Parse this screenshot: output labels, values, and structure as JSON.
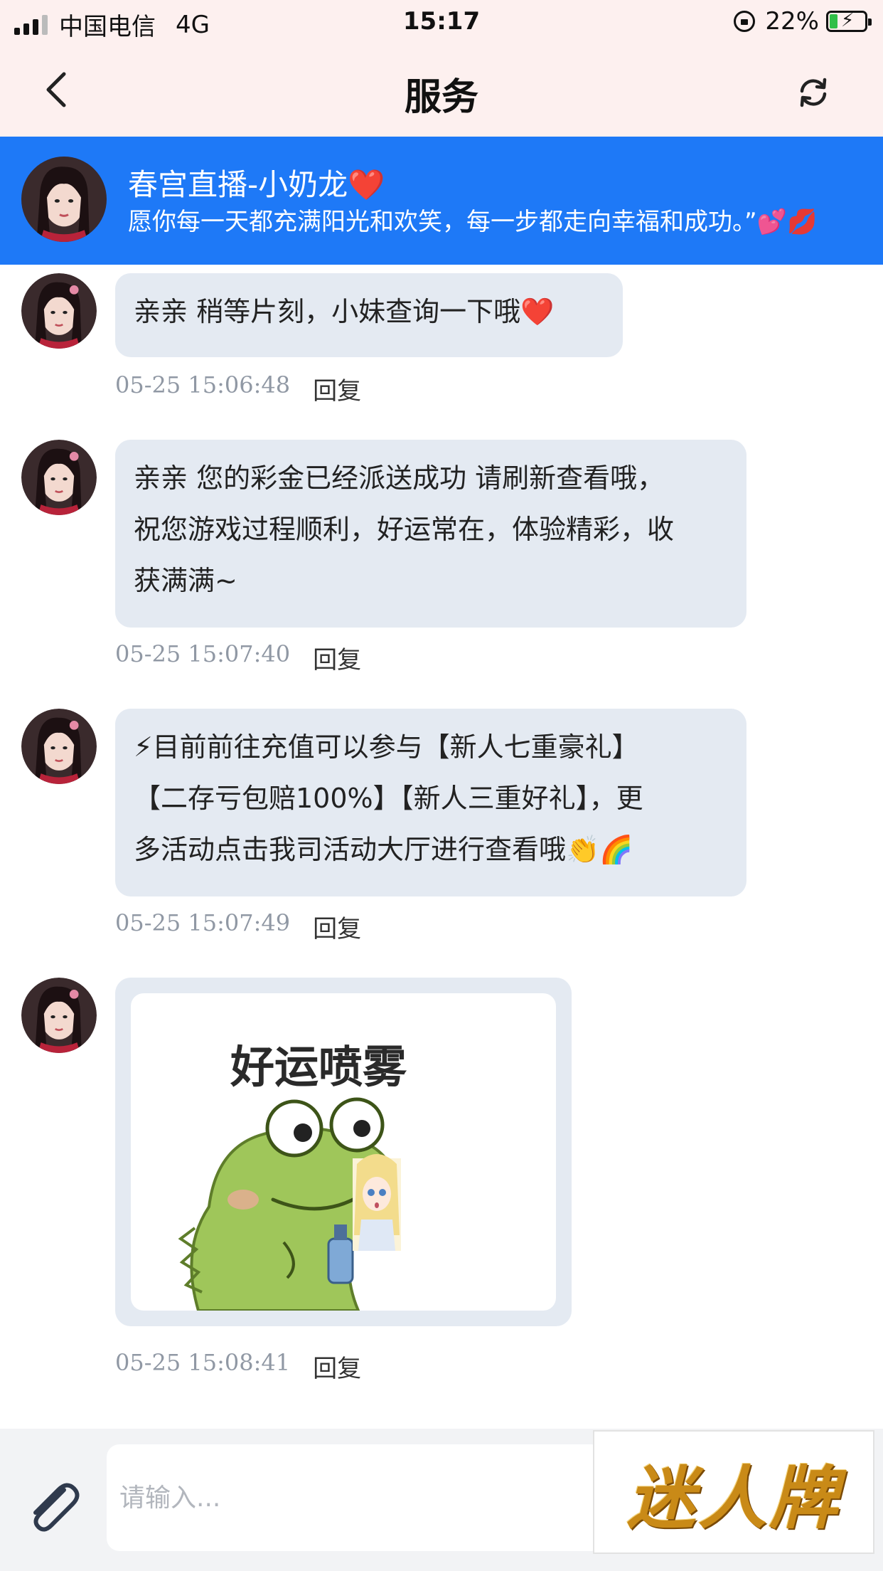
{
  "status_bar": {
    "carrier": "中国电信",
    "network": "4G",
    "time": "15:17",
    "battery_percent": "22%",
    "battery_level": 0.22,
    "battery_color": "#2fbf48"
  },
  "nav": {
    "title": "服务",
    "back_icon": "chevron-left-icon",
    "refresh_icon": "refresh-icon"
  },
  "agent": {
    "name": "春宫直播-小奶龙❤️",
    "motto": "愿你每一天都充满阳光和欢笑，每一步都走向幸福和成功。”💕💋",
    "banner_color": "#1e79f7"
  },
  "messages": [
    {
      "lines": [
        "亲亲  稍等片刻，小妹查询一下哦❤️"
      ],
      "timestamp": "05-25 15:06:48",
      "reply_label": "回复"
    },
    {
      "lines": [
        "亲亲 您的彩金已经派送成功 请刷新查看哦，",
        "祝您游戏过程顺利，好运常在，体验精彩，收",
        "获满满~"
      ],
      "timestamp": "05-25 15:07:40",
      "reply_label": "回复"
    },
    {
      "lines": [
        "⚡目前前往充值可以参与【新人七重豪礼】",
        "【二存亏包赔100%】【新人三重好礼】，更",
        "多活动点击我司活动大厅进行查看哦👏🌈"
      ],
      "timestamp": "05-25 15:07:49",
      "reply_label": "回复"
    },
    {
      "sticker_text": "好运喷雾",
      "timestamp": "05-25 15:08:41",
      "reply_label": "回复"
    }
  ],
  "input": {
    "placeholder": "请输入...",
    "attach_icon": "paperclip-icon"
  },
  "brand": {
    "text": "迷人牌"
  }
}
